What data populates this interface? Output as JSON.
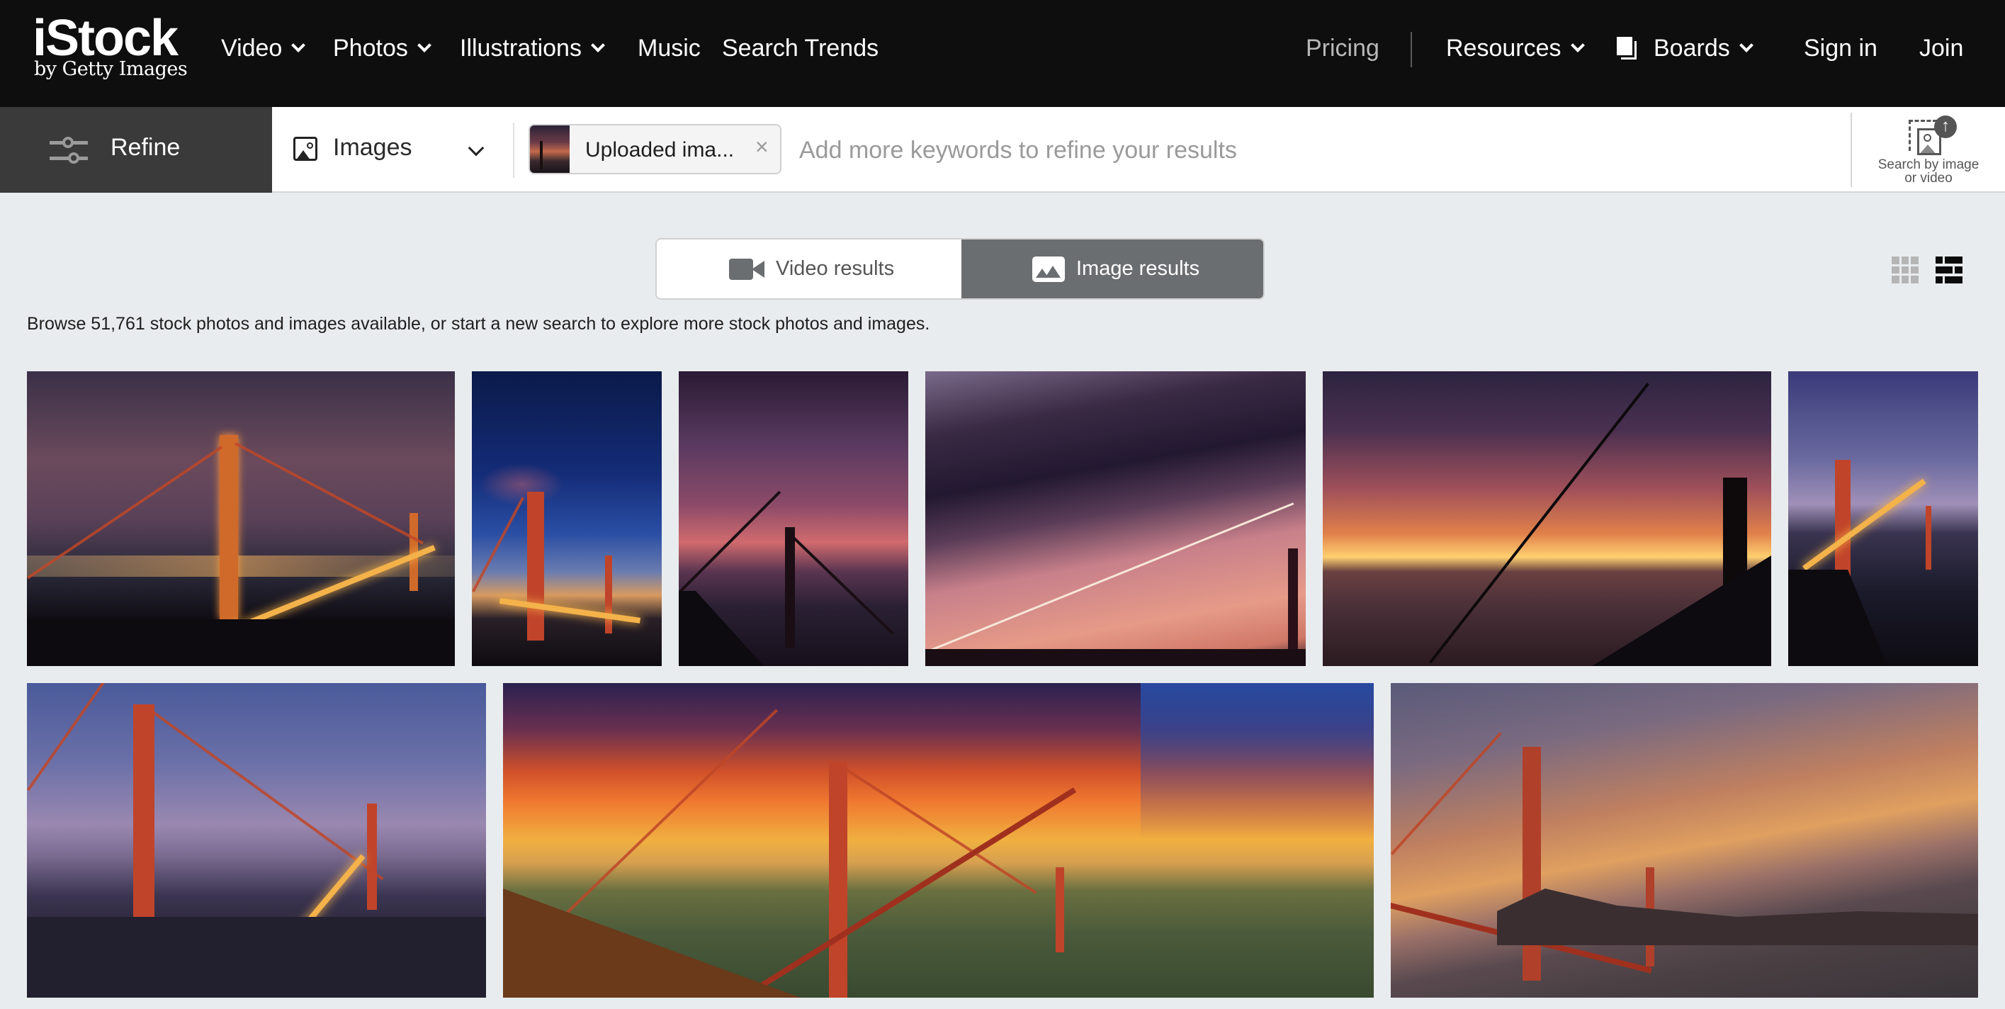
{
  "nav": {
    "logo_main": "iStock",
    "logo_sub": "by Getty Images",
    "left_items": [
      {
        "label": "Video",
        "has_dropdown": true
      },
      {
        "label": "Photos",
        "has_dropdown": true
      },
      {
        "label": "Illustrations",
        "has_dropdown": true
      },
      {
        "label": "Music",
        "has_dropdown": false
      },
      {
        "label": "Search Trends",
        "has_dropdown": false
      }
    ],
    "pricing": "Pricing",
    "resources": "Resources",
    "boards": "Boards",
    "sign_in": "Sign in",
    "join": "Join"
  },
  "search": {
    "refine_label": "Refine",
    "type_selected": "Images",
    "chip_label": "Uploaded ima...",
    "chip_close": "×",
    "keywords_placeholder": "Add more keywords to refine your results",
    "keywords_value": "",
    "search_by_image_label_1": "Search by image",
    "search_by_image_label_2": "or video"
  },
  "results": {
    "toggle": {
      "video_label": "Video results",
      "image_label": "Image results",
      "active": "image"
    },
    "view_modes": [
      {
        "name": "grid",
        "active": false
      },
      {
        "name": "mosaic",
        "active": true
      }
    ],
    "browse_text": "Browse 51,761 stock photos and images available, or start a new search to explore more stock photos and images.",
    "images": [
      {
        "description": "Golden Gate Bridge at night with city lights and fog"
      },
      {
        "description": "Golden Gate Bridge tower at blue hour"
      },
      {
        "description": "Golden Gate Bridge silhouette under purple cloudy sky"
      },
      {
        "description": "Bridge cables against pink sunset with dark clouds"
      },
      {
        "description": "Golden Gate Bridge silhouette at fiery sunset over bay"
      },
      {
        "description": "Golden Gate Bridge lit at dusk from above"
      },
      {
        "description": "Golden Gate Bridge at dusk with light trails"
      },
      {
        "description": "Golden Gate Bridge aerial at dramatic orange sunset"
      },
      {
        "description": "Golden Gate Bridge at sunset with streaked clouds"
      }
    ]
  },
  "colors": {
    "nav_bg": "#0e0e0e",
    "refine_bg": "#3a3a3a",
    "page_bg": "#e9ecee",
    "toggle_active": "#6b6e70"
  }
}
